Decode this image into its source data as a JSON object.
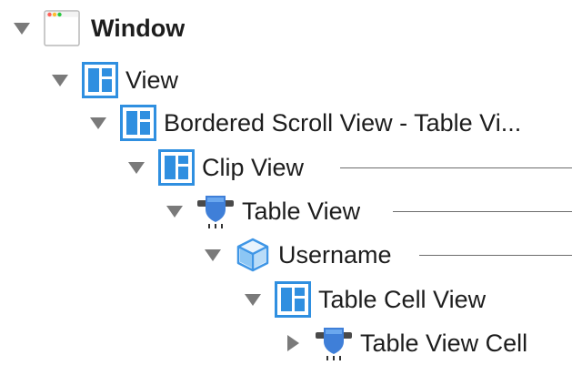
{
  "tree": {
    "items": [
      {
        "label": "Window",
        "icon": "window-icon",
        "expanded": true,
        "bold": true
      },
      {
        "label": "View",
        "icon": "view-icon",
        "expanded": true
      },
      {
        "label": "Bordered Scroll View - Table Vi...",
        "icon": "view-icon",
        "expanded": true
      },
      {
        "label": "Clip View",
        "icon": "view-icon",
        "expanded": true,
        "connector": true
      },
      {
        "label": "Table View",
        "icon": "table-view-icon",
        "expanded": true,
        "connector": true
      },
      {
        "label": "Username",
        "icon": "cube-icon",
        "expanded": true,
        "connector": true
      },
      {
        "label": "Table Cell View",
        "icon": "view-icon",
        "expanded": true
      },
      {
        "label": "Table View Cell",
        "icon": "table-view-icon",
        "expanded": false
      }
    ]
  },
  "colors": {
    "accent": "#2f8fe0",
    "accent_fill": "#5ab0ee",
    "disclosure": "#7a7a7a",
    "connector": "#6d6d6d",
    "traffic_red": "#ff5f57",
    "traffic_yellow": "#febc2e",
    "traffic_green": "#28c840"
  }
}
